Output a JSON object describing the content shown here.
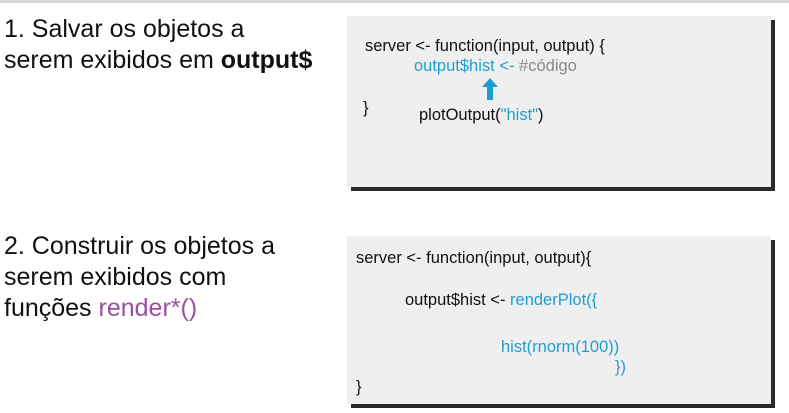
{
  "step1": {
    "text_prefix": "1. Salvar os objetos a\nserem exibidos em ",
    "text_bold": "output$"
  },
  "step2": {
    "text_prefix": "2. Construir os objetos a\nserem exibidos com\nfunções ",
    "text_highlight": "render*()"
  },
  "code1": {
    "line1": "server <- function(input, output) {",
    "line2_blue": "output$hist <-",
    "line2_comment": " #código",
    "line3_brace": "}",
    "line3_call_prefix": "plotOutput(",
    "line3_call_arg": "\"hist\"",
    "line3_call_suffix": ")"
  },
  "code2": {
    "line1": "server <- function(input, output){",
    "line2_prefix": "output$hist <- ",
    "line2_blue": "renderPlot({",
    "line3_blue": "hist(rnorm(100))",
    "line4_blue": "})",
    "line5": "}"
  },
  "colors": {
    "code_blue": "#1e9fd0",
    "render_purple": "#9b4fa0",
    "box_bg": "#efefef",
    "box_shadow": "#2a2a2a"
  },
  "icons": {
    "arrow": "up-arrow-icon"
  }
}
